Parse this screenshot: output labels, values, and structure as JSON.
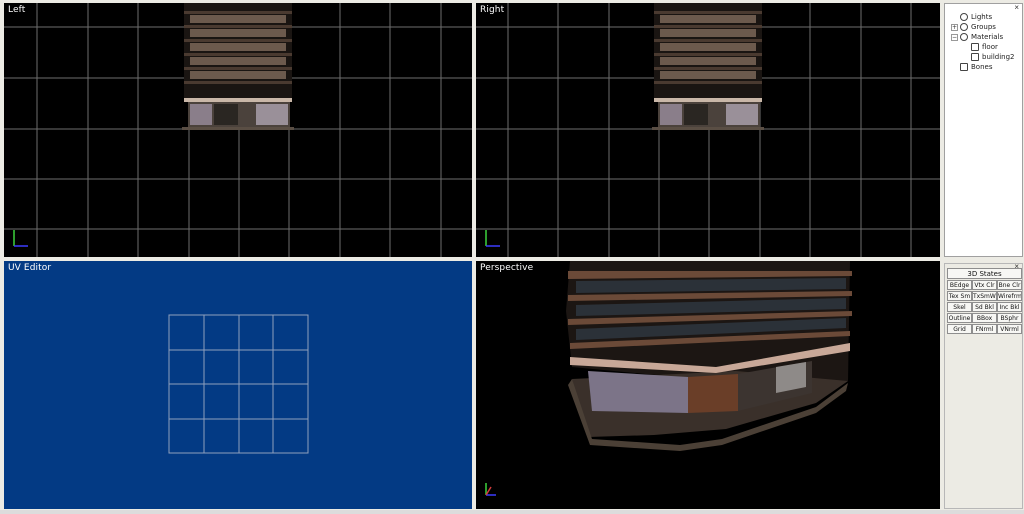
{
  "viewports": {
    "left": {
      "title": "Left"
    },
    "right": {
      "title": "Right"
    },
    "uv": {
      "title": "UV Editor"
    },
    "perspective": {
      "title": "Perspective"
    }
  },
  "scene_tree": {
    "items": [
      {
        "label": "Lights",
        "expander": ""
      },
      {
        "label": "Groups",
        "expander": "+"
      },
      {
        "label": "Materials",
        "expander": "−"
      },
      {
        "label": "floor",
        "expander": ""
      },
      {
        "label": "building2",
        "expander": ""
      },
      {
        "label": "Bones",
        "expander": ""
      }
    ],
    "close": "×"
  },
  "states_panel": {
    "title": "3D States",
    "close": "×",
    "buttons": [
      [
        "BEdge",
        "Vtx Clr",
        "Bne Clr"
      ],
      [
        "Tex Sm",
        "TxSmWr",
        "Wirefrme"
      ],
      [
        "Skel",
        "Sd Bkl",
        "Inc Bkl"
      ],
      [
        "Outline",
        "BBox",
        "BSphr"
      ],
      [
        "Grid",
        "FNrml",
        "VNrml"
      ]
    ]
  },
  "colors": {
    "viewport_bg": "#000000",
    "uv_bg": "#033a84",
    "grid_line": "#7a7a7a",
    "axis_x": "#3c3cff",
    "axis_y": "#3cd23c"
  }
}
